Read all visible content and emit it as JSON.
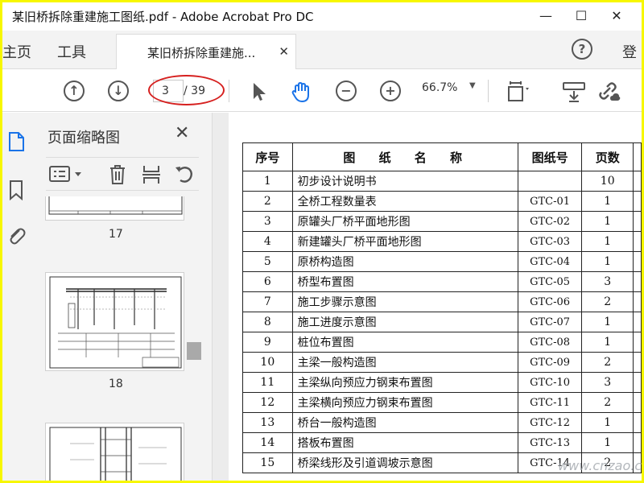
{
  "window": {
    "title": "某旧桥拆除重建施工图纸.pdf - Adobe Acrobat Pro DC",
    "minimize_glyph": "—",
    "maximize_glyph": "☐",
    "close_glyph": "✕"
  },
  "tabs": {
    "home": "主页",
    "tools": "工具",
    "document": "某旧桥拆除重建施...",
    "document_close": "✕",
    "help": "?",
    "login": "登"
  },
  "toolbar": {
    "current_page": "3",
    "total_pages": "/ 39",
    "zoom": "66.7%",
    "prev_icon": "arrow-up-circle-icon",
    "next_icon": "arrow-down-circle-icon",
    "zoom_out_glyph": "−",
    "zoom_in_glyph": "+",
    "prev_glyph": "↑",
    "next_glyph": "↓",
    "caret_glyph": "▼",
    "annotation_color": "#d6201f"
  },
  "thumbnails_panel": {
    "title": "页面缩略图",
    "close_glyph": "✕",
    "items": [
      {
        "page": "17"
      },
      {
        "page": "18"
      }
    ],
    "collapse_glyph": "◀"
  },
  "document": {
    "headers": [
      "序号",
      "图 纸 名 称",
      "图纸号",
      "页数"
    ],
    "rows": [
      [
        "1",
        "初步设计说明书",
        "",
        "10"
      ],
      [
        "2",
        "全桥工程数量表",
        "GTC-01",
        "1"
      ],
      [
        "3",
        "原罐头厂桥平面地形图",
        "GTC-02",
        "1"
      ],
      [
        "4",
        "新建罐头厂桥平面地形图",
        "GTC-03",
        "1"
      ],
      [
        "5",
        "原桥构造图",
        "GTC-04",
        "1"
      ],
      [
        "6",
        "桥型布置图",
        "GTC-05",
        "3"
      ],
      [
        "7",
        "施工步骤示意图",
        "GTC-06",
        "2"
      ],
      [
        "8",
        "施工进度示意图",
        "GTC-07",
        "1"
      ],
      [
        "9",
        "桩位布置图",
        "GTC-08",
        "1"
      ],
      [
        "10",
        "主梁一般构造图",
        "GTC-09",
        "2"
      ],
      [
        "11",
        "主梁纵向预应力钢束布置图",
        "GTC-10",
        "3"
      ],
      [
        "12",
        "主梁横向预应力钢束布置图",
        "GTC-11",
        "2"
      ],
      [
        "13",
        "桥台一般构造图",
        "GTC-12",
        "1"
      ],
      [
        "14",
        "搭板布置图",
        "GTC-13",
        "1"
      ],
      [
        "15",
        "桥梁线形及引道调坡示意图",
        "GTC-14",
        "2"
      ]
    ]
  },
  "watermark": "www.cnzao.com",
  "colors": {
    "frame": "#f7f700",
    "annotation": "#d6201f",
    "active_icon": "#1a73e8"
  }
}
